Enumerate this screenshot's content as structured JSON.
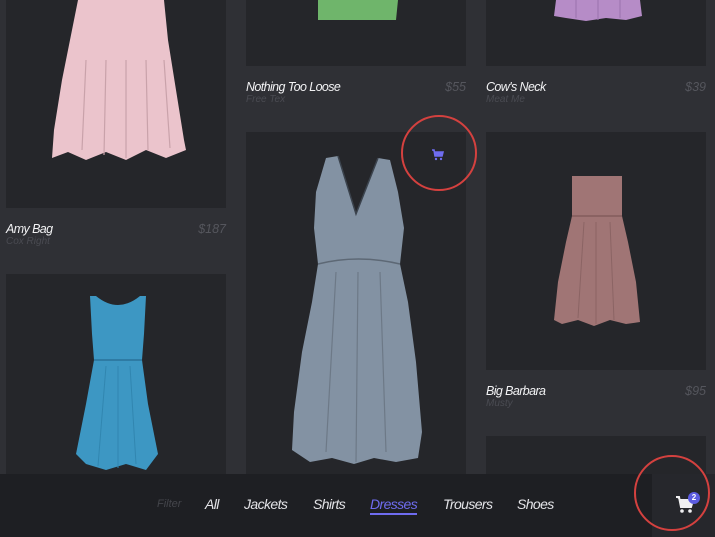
{
  "products": [
    {
      "name": "Nothing Too Loose",
      "vendor": "Free Tex",
      "price": "$55",
      "color": "#6fb56b"
    },
    {
      "name": "Cow's Neck",
      "vendor": "Meat Me",
      "price": "$39",
      "color": "#b68cc7"
    },
    {
      "name": "Amy Bag",
      "vendor": "Cox Right",
      "price": "$187",
      "color": "#ebc4cc"
    },
    {
      "name": "Big Barbara",
      "vendor": "Musty",
      "price": "$95",
      "color": "#a07575"
    },
    {
      "name": "",
      "vendor": "",
      "price": "",
      "color": "#8392a3"
    },
    {
      "name": "",
      "vendor": "",
      "price": "",
      "color": "#3d97c3"
    }
  ],
  "filter": {
    "label": "Filter",
    "items": [
      "All",
      "Jackets",
      "Shirts",
      "Dresses",
      "Trousers",
      "Shoes"
    ],
    "active": "Dresses"
  },
  "cart": {
    "count": "2",
    "icon": "shopping-cart-icon"
  },
  "colors": {
    "accent": "#6f6cf0",
    "highlight": "#d4413f",
    "background": "#2f3035"
  }
}
